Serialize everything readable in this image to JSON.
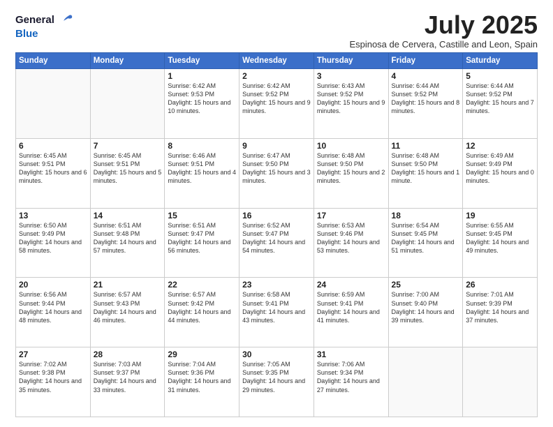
{
  "logo": {
    "general": "General",
    "blue": "Blue"
  },
  "header": {
    "title": "July 2025",
    "subtitle": "Espinosa de Cervera, Castille and Leon, Spain"
  },
  "days_of_week": [
    "Sunday",
    "Monday",
    "Tuesday",
    "Wednesday",
    "Thursday",
    "Friday",
    "Saturday"
  ],
  "weeks": [
    [
      {
        "day": null
      },
      {
        "day": null
      },
      {
        "day": "1",
        "sunrise": "Sunrise: 6:42 AM",
        "sunset": "Sunset: 9:53 PM",
        "daylight": "Daylight: 15 hours and 10 minutes."
      },
      {
        "day": "2",
        "sunrise": "Sunrise: 6:42 AM",
        "sunset": "Sunset: 9:52 PM",
        "daylight": "Daylight: 15 hours and 9 minutes."
      },
      {
        "day": "3",
        "sunrise": "Sunrise: 6:43 AM",
        "sunset": "Sunset: 9:52 PM",
        "daylight": "Daylight: 15 hours and 9 minutes."
      },
      {
        "day": "4",
        "sunrise": "Sunrise: 6:44 AM",
        "sunset": "Sunset: 9:52 PM",
        "daylight": "Daylight: 15 hours and 8 minutes."
      },
      {
        "day": "5",
        "sunrise": "Sunrise: 6:44 AM",
        "sunset": "Sunset: 9:52 PM",
        "daylight": "Daylight: 15 hours and 7 minutes."
      }
    ],
    [
      {
        "day": "6",
        "sunrise": "Sunrise: 6:45 AM",
        "sunset": "Sunset: 9:51 PM",
        "daylight": "Daylight: 15 hours and 6 minutes."
      },
      {
        "day": "7",
        "sunrise": "Sunrise: 6:45 AM",
        "sunset": "Sunset: 9:51 PM",
        "daylight": "Daylight: 15 hours and 5 minutes."
      },
      {
        "day": "8",
        "sunrise": "Sunrise: 6:46 AM",
        "sunset": "Sunset: 9:51 PM",
        "daylight": "Daylight: 15 hours and 4 minutes."
      },
      {
        "day": "9",
        "sunrise": "Sunrise: 6:47 AM",
        "sunset": "Sunset: 9:50 PM",
        "daylight": "Daylight: 15 hours and 3 minutes."
      },
      {
        "day": "10",
        "sunrise": "Sunrise: 6:48 AM",
        "sunset": "Sunset: 9:50 PM",
        "daylight": "Daylight: 15 hours and 2 minutes."
      },
      {
        "day": "11",
        "sunrise": "Sunrise: 6:48 AM",
        "sunset": "Sunset: 9:50 PM",
        "daylight": "Daylight: 15 hours and 1 minute."
      },
      {
        "day": "12",
        "sunrise": "Sunrise: 6:49 AM",
        "sunset": "Sunset: 9:49 PM",
        "daylight": "Daylight: 15 hours and 0 minutes."
      }
    ],
    [
      {
        "day": "13",
        "sunrise": "Sunrise: 6:50 AM",
        "sunset": "Sunset: 9:49 PM",
        "daylight": "Daylight: 14 hours and 58 minutes."
      },
      {
        "day": "14",
        "sunrise": "Sunrise: 6:51 AM",
        "sunset": "Sunset: 9:48 PM",
        "daylight": "Daylight: 14 hours and 57 minutes."
      },
      {
        "day": "15",
        "sunrise": "Sunrise: 6:51 AM",
        "sunset": "Sunset: 9:47 PM",
        "daylight": "Daylight: 14 hours and 56 minutes."
      },
      {
        "day": "16",
        "sunrise": "Sunrise: 6:52 AM",
        "sunset": "Sunset: 9:47 PM",
        "daylight": "Daylight: 14 hours and 54 minutes."
      },
      {
        "day": "17",
        "sunrise": "Sunrise: 6:53 AM",
        "sunset": "Sunset: 9:46 PM",
        "daylight": "Daylight: 14 hours and 53 minutes."
      },
      {
        "day": "18",
        "sunrise": "Sunrise: 6:54 AM",
        "sunset": "Sunset: 9:45 PM",
        "daylight": "Daylight: 14 hours and 51 minutes."
      },
      {
        "day": "19",
        "sunrise": "Sunrise: 6:55 AM",
        "sunset": "Sunset: 9:45 PM",
        "daylight": "Daylight: 14 hours and 49 minutes."
      }
    ],
    [
      {
        "day": "20",
        "sunrise": "Sunrise: 6:56 AM",
        "sunset": "Sunset: 9:44 PM",
        "daylight": "Daylight: 14 hours and 48 minutes."
      },
      {
        "day": "21",
        "sunrise": "Sunrise: 6:57 AM",
        "sunset": "Sunset: 9:43 PM",
        "daylight": "Daylight: 14 hours and 46 minutes."
      },
      {
        "day": "22",
        "sunrise": "Sunrise: 6:57 AM",
        "sunset": "Sunset: 9:42 PM",
        "daylight": "Daylight: 14 hours and 44 minutes."
      },
      {
        "day": "23",
        "sunrise": "Sunrise: 6:58 AM",
        "sunset": "Sunset: 9:41 PM",
        "daylight": "Daylight: 14 hours and 43 minutes."
      },
      {
        "day": "24",
        "sunrise": "Sunrise: 6:59 AM",
        "sunset": "Sunset: 9:41 PM",
        "daylight": "Daylight: 14 hours and 41 minutes."
      },
      {
        "day": "25",
        "sunrise": "Sunrise: 7:00 AM",
        "sunset": "Sunset: 9:40 PM",
        "daylight": "Daylight: 14 hours and 39 minutes."
      },
      {
        "day": "26",
        "sunrise": "Sunrise: 7:01 AM",
        "sunset": "Sunset: 9:39 PM",
        "daylight": "Daylight: 14 hours and 37 minutes."
      }
    ],
    [
      {
        "day": "27",
        "sunrise": "Sunrise: 7:02 AM",
        "sunset": "Sunset: 9:38 PM",
        "daylight": "Daylight: 14 hours and 35 minutes."
      },
      {
        "day": "28",
        "sunrise": "Sunrise: 7:03 AM",
        "sunset": "Sunset: 9:37 PM",
        "daylight": "Daylight: 14 hours and 33 minutes."
      },
      {
        "day": "29",
        "sunrise": "Sunrise: 7:04 AM",
        "sunset": "Sunset: 9:36 PM",
        "daylight": "Daylight: 14 hours and 31 minutes."
      },
      {
        "day": "30",
        "sunrise": "Sunrise: 7:05 AM",
        "sunset": "Sunset: 9:35 PM",
        "daylight": "Daylight: 14 hours and 29 minutes."
      },
      {
        "day": "31",
        "sunrise": "Sunrise: 7:06 AM",
        "sunset": "Sunset: 9:34 PM",
        "daylight": "Daylight: 14 hours and 27 minutes."
      },
      {
        "day": null
      },
      {
        "day": null
      }
    ]
  ]
}
